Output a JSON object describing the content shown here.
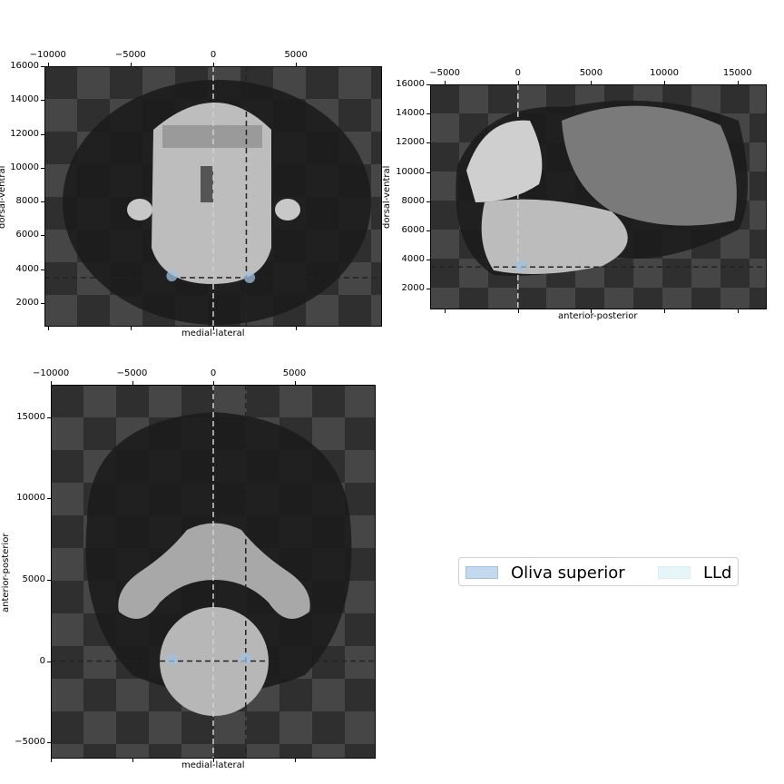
{
  "chart_data": [
    {
      "type": "image",
      "view": "coronal",
      "xlabel": "medial-lateral",
      "ylabel": "dorsal-ventral",
      "x_ticks": [
        "−10000",
        "−5000",
        "0",
        "5000"
      ],
      "y_ticks": [
        "16000",
        "14000",
        "12000",
        "10000",
        "8000",
        "6000",
        "4000",
        "2000"
      ],
      "xlim": [
        -10200,
        10200
      ],
      "ylim": [
        600,
        16000
      ],
      "crosshair": {
        "x": [
          0,
          2000
        ],
        "y": 3500
      },
      "markers": [
        {
          "x": -2500,
          "y": 3600
        },
        {
          "x": 2200,
          "y": 3500
        }
      ]
    },
    {
      "type": "image",
      "view": "sagittal",
      "xlabel": "anterior-posterior",
      "ylabel": "dorsal-ventral",
      "x_ticks": [
        "−5000",
        "0",
        "5000",
        "10000",
        "15000"
      ],
      "y_ticks": [
        "16000",
        "14000",
        "12000",
        "10000",
        "8000",
        "6000",
        "4000",
        "2000"
      ],
      "xlim": [
        -6000,
        17000
      ],
      "ylim": [
        600,
        16000
      ],
      "crosshair": {
        "x": [
          0
        ],
        "y": 3500
      },
      "markers": [
        {
          "x": 200,
          "y": 3600
        }
      ]
    },
    {
      "type": "image",
      "view": "horizontal",
      "xlabel": "medial-lateral",
      "ylabel": "anterior-posterior",
      "x_ticks": [
        "−10000",
        "−5000",
        "0",
        "5000"
      ],
      "y_ticks": [
        "15000",
        "10000",
        "5000",
        "0",
        "−5000"
      ],
      "xlim": [
        -10000,
        10000
      ],
      "ylim": [
        -6000,
        17000
      ],
      "crosshair": {
        "x": [
          0,
          2000
        ],
        "y": 0
      },
      "markers": [
        {
          "x": -2500,
          "y": 100
        },
        {
          "x": 2000,
          "y": 200
        }
      ]
    }
  ],
  "legend": {
    "items": [
      {
        "label": "Oliva superior",
        "color": "#9ec1e0"
      },
      {
        "label": "LLd",
        "color": "#d6f0f5"
      }
    ]
  }
}
